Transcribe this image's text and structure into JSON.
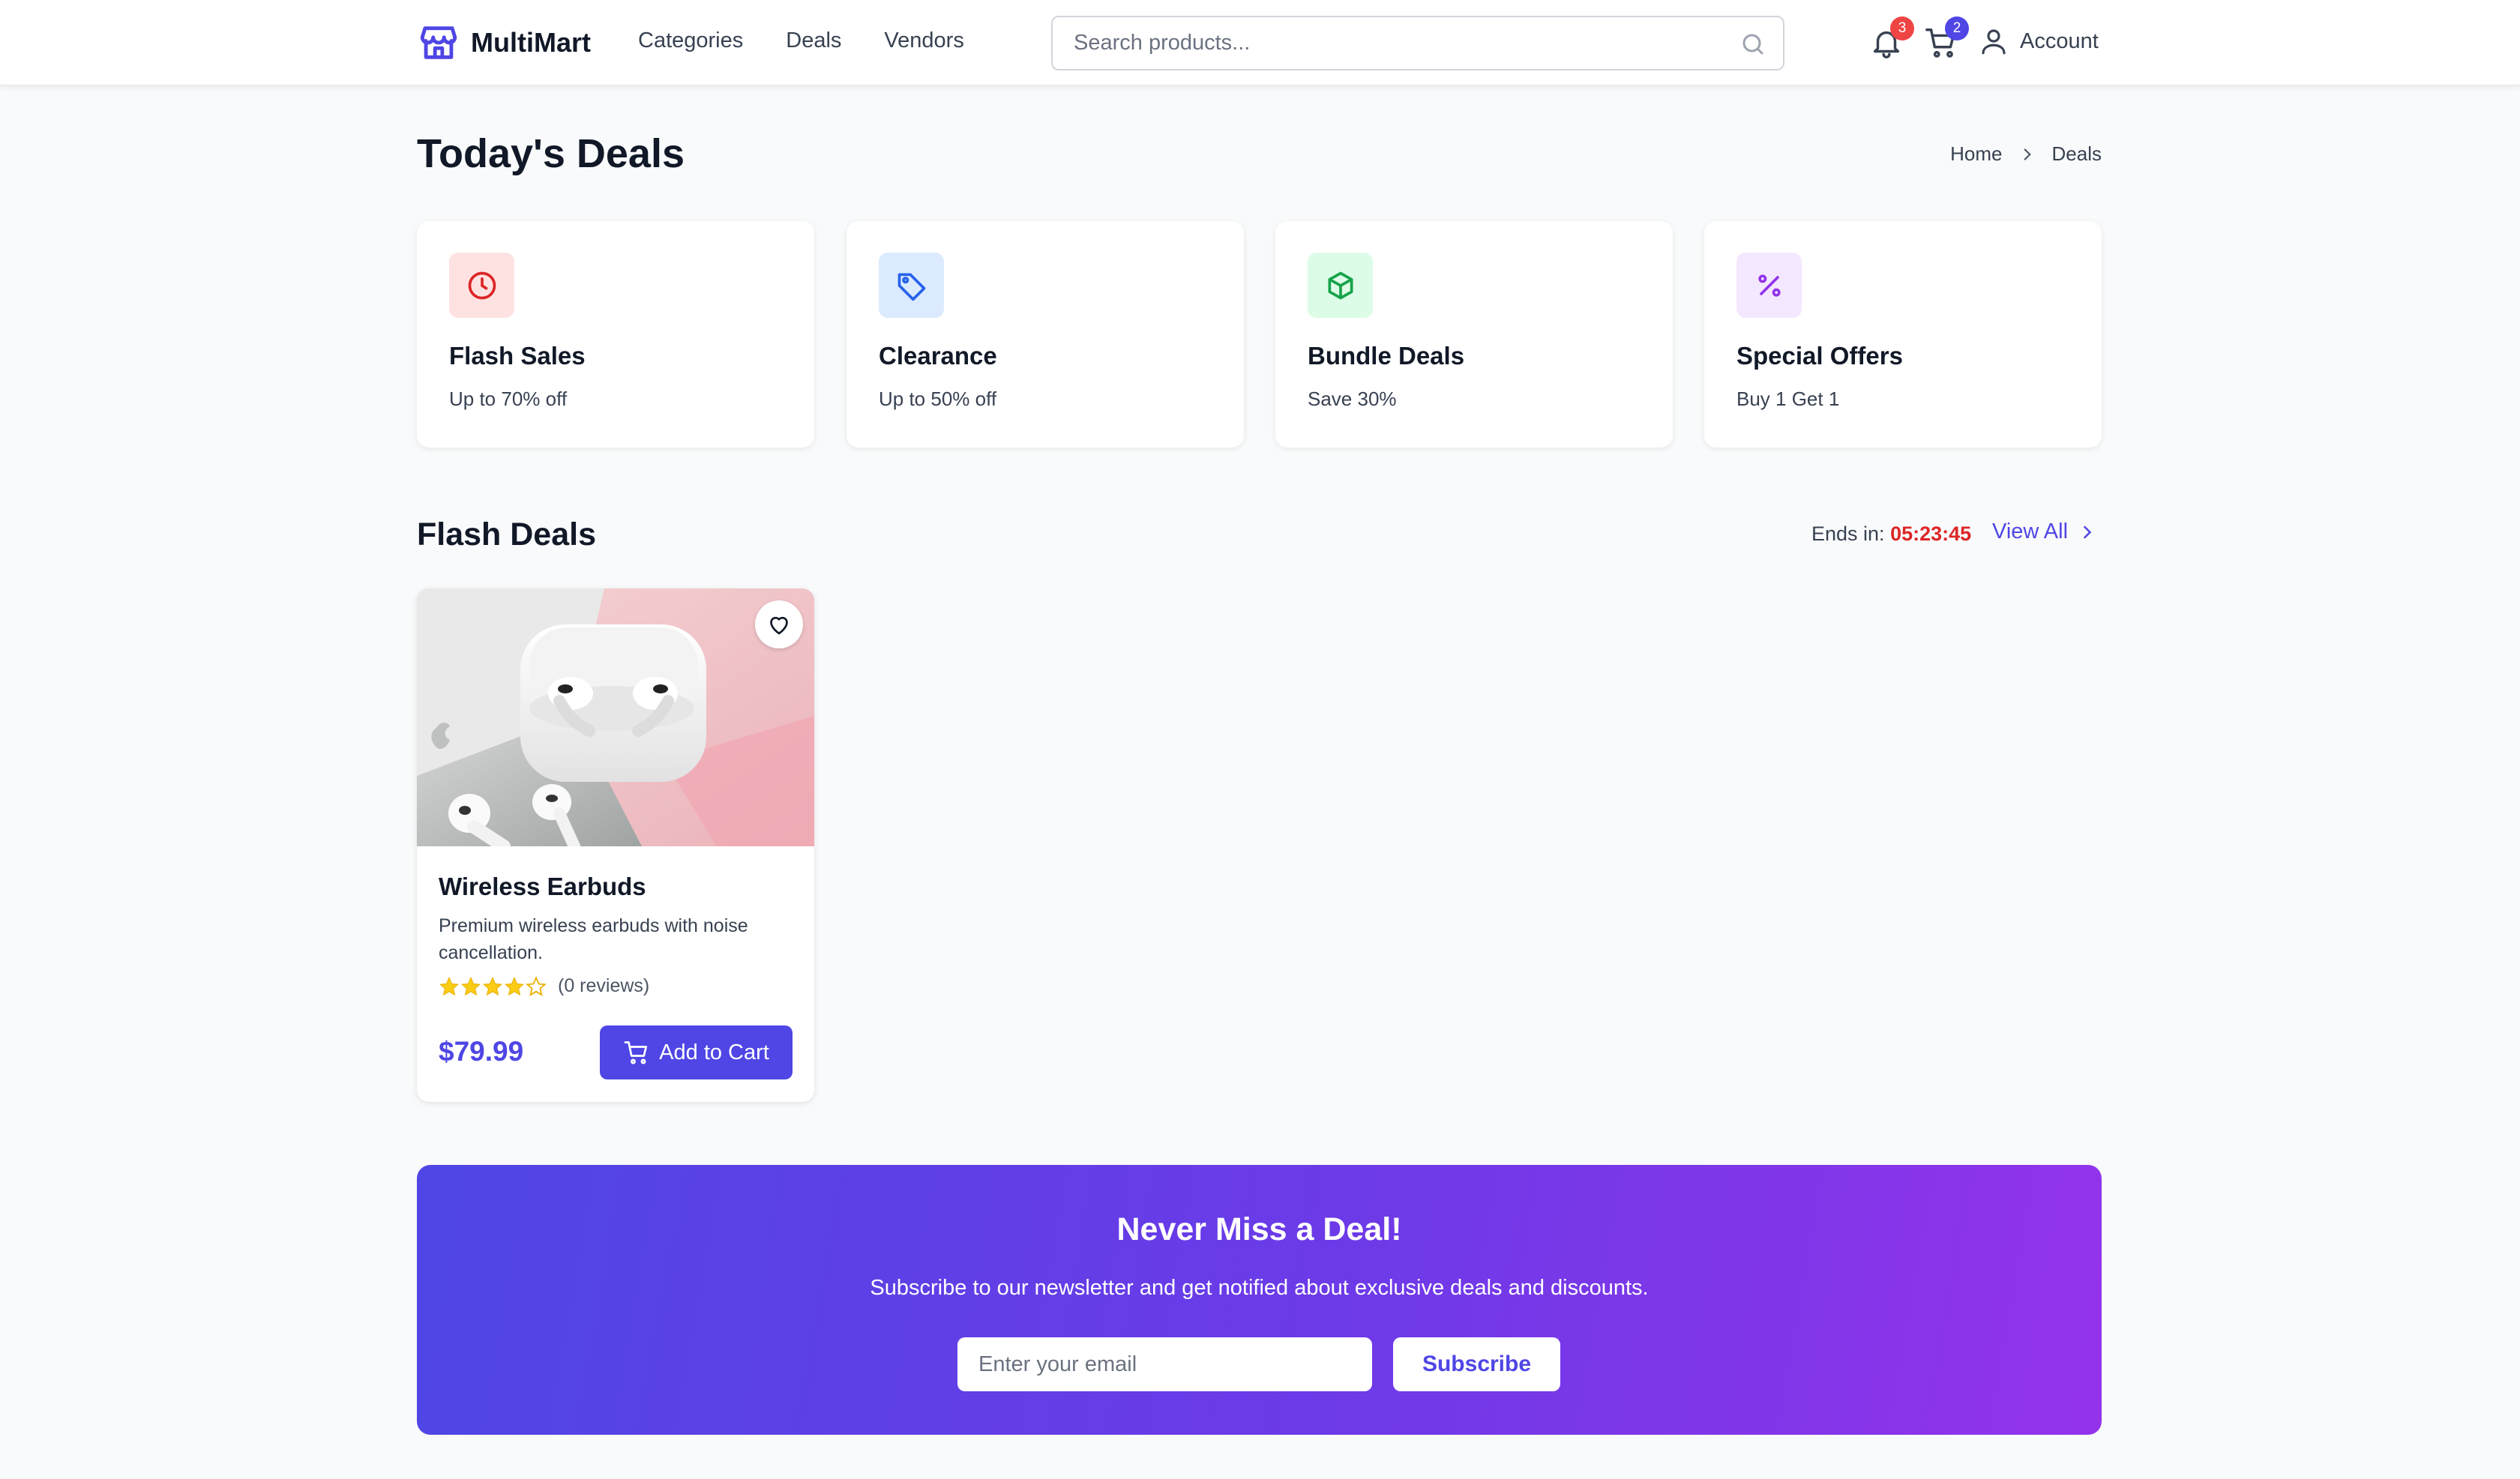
{
  "header": {
    "brand": "MultiMart",
    "nav": [
      "Categories",
      "Deals",
      "Vendors"
    ],
    "search_placeholder": "Search products...",
    "notifications_count": "3",
    "cart_count": "2",
    "account_label": "Account"
  },
  "page": {
    "title": "Today's Deals",
    "breadcrumb": [
      "Home",
      "Deals"
    ]
  },
  "categories": [
    {
      "title": "Flash Sales",
      "subtitle": "Up to 70% off",
      "icon": "clock-icon",
      "bg": "#fee2e2",
      "color": "#dc2626"
    },
    {
      "title": "Clearance",
      "subtitle": "Up to 50% off",
      "icon": "tag-icon",
      "bg": "#dbeafe",
      "color": "#2563eb"
    },
    {
      "title": "Bundle Deals",
      "subtitle": "Save 30%",
      "icon": "box-icon",
      "bg": "#dcfce7",
      "color": "#16a34a"
    },
    {
      "title": "Special Offers",
      "subtitle": "Buy 1 Get 1",
      "icon": "percent-icon",
      "bg": "#f3e8ff",
      "color": "#9333ea"
    }
  ],
  "flash": {
    "title": "Flash Deals",
    "ends_label": "Ends in:",
    "countdown": "05:23:45",
    "view_all": "View All"
  },
  "product": {
    "name": "Wireless Earbuds",
    "description": "Premium wireless earbuds with noise cancellation.",
    "rating": 4,
    "rating_max": 5,
    "reviews": "(0 reviews)",
    "price": "$79.99",
    "cta": "Add to Cart"
  },
  "newsletter": {
    "title": "Never Miss a Deal!",
    "subtitle": "Subscribe to our newsletter and get notified about exclusive deals and discounts.",
    "placeholder": "Enter your email",
    "button": "Subscribe"
  },
  "colors": {
    "accent": "#4f46e5",
    "countdown": "#dc2626",
    "star": "#facc15"
  }
}
